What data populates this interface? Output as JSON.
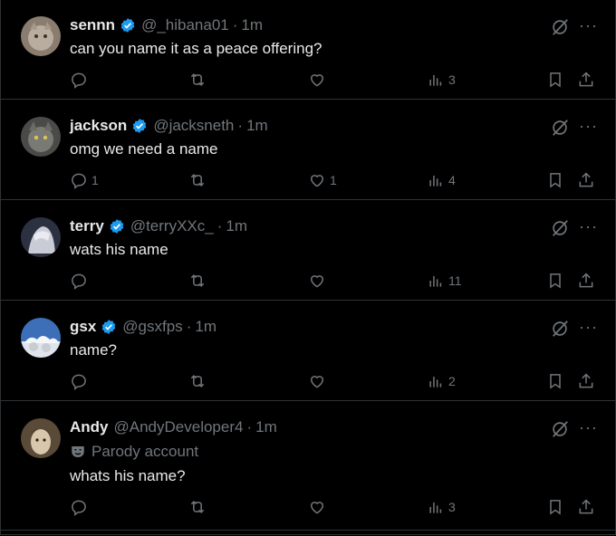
{
  "posts": [
    {
      "name": "sennn",
      "handle": "@_hibana01",
      "dot": "·",
      "time": "1m",
      "verified": true,
      "text": "can you name it as a peace offering?",
      "replies": "",
      "likes": "",
      "views": "3"
    },
    {
      "name": "jackson",
      "handle": "@jacksneth",
      "dot": "·",
      "time": "1m",
      "verified": true,
      "text": "omg we need a name",
      "replies": "1",
      "likes": "1",
      "views": "4"
    },
    {
      "name": "terry",
      "handle": "@terryXXc_",
      "dot": "·",
      "time": "1m",
      "verified": true,
      "text": "wats his name",
      "replies": "",
      "likes": "",
      "views": "11"
    },
    {
      "name": "gsx",
      "handle": "@gsxfps",
      "dot": "·",
      "time": "1m",
      "verified": true,
      "text": "name?",
      "replies": "",
      "likes": "",
      "views": "2"
    },
    {
      "name": "Andy",
      "handle": "@AndyDeveloper4",
      "dot": "·",
      "time": "1m",
      "verified": false,
      "parody_label": "Parody account",
      "text": "whats his name?",
      "replies": "",
      "likes": "",
      "views": "3"
    }
  ],
  "icons": {
    "reply": "reply-icon",
    "repost": "repost-icon",
    "like": "like-icon",
    "views": "views-icon",
    "bookmark": "bookmark-icon",
    "share": "share-icon",
    "grok": "grok-icon",
    "more": "more-icon",
    "verified": "verified-badge-icon",
    "parody": "parody-mask-icon"
  },
  "more_glyph": "···",
  "colors": {
    "background": "#000000",
    "text": "#e7e9ea",
    "muted": "#71767b",
    "verified": "#1d9bf0",
    "divider": "#2f3336"
  }
}
